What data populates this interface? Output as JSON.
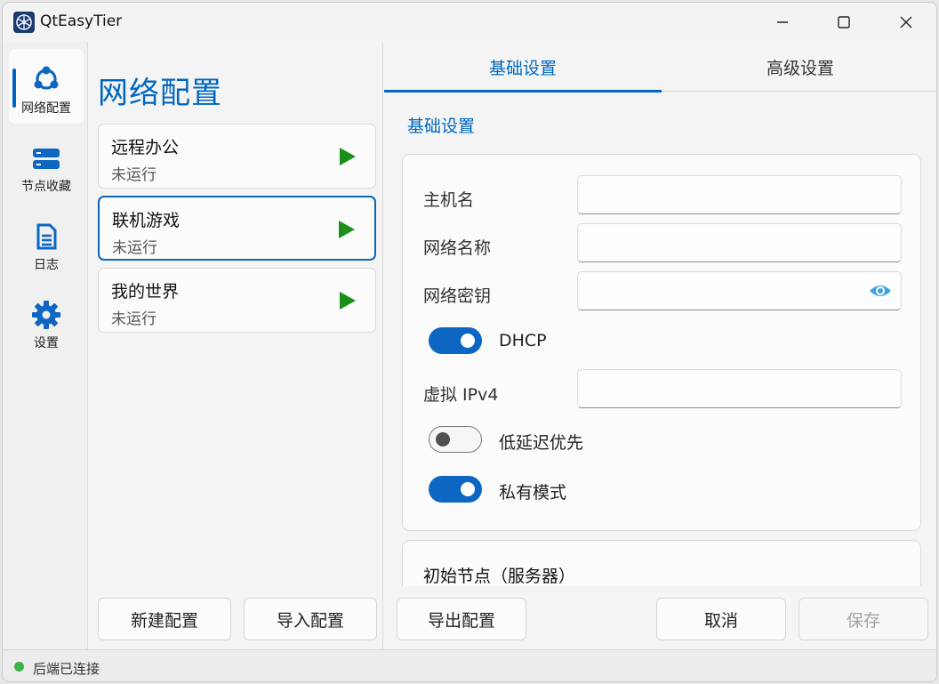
{
  "app": {
    "title": "QtEasyTier"
  },
  "nav": {
    "items": [
      {
        "label": "网络配置",
        "icon": "network-icon",
        "active": true
      },
      {
        "label": "节点收藏",
        "icon": "server-icon",
        "active": false
      },
      {
        "label": "日志",
        "icon": "document-icon",
        "active": false
      },
      {
        "label": "设置",
        "icon": "gear-icon",
        "active": false
      }
    ]
  },
  "config_list": {
    "title": "网络配置",
    "items": [
      {
        "name": "远程办公",
        "status": "未运行"
      },
      {
        "name": "联机游戏",
        "status": "未运行"
      },
      {
        "name": "我的世界",
        "status": "未运行"
      }
    ],
    "new_button": "新建配置",
    "import_button": "导入配置"
  },
  "tabs": [
    {
      "label": "基础设置",
      "active": true
    },
    {
      "label": "高级设置",
      "active": false
    }
  ],
  "basic": {
    "section_title": "基础设置",
    "hostname_label": "主机名",
    "hostname_value": "",
    "network_name_label": "网络名称",
    "network_name_value": "",
    "network_secret_label": "网络密钥",
    "network_secret_value": "",
    "dhcp_label": "DHCP",
    "dhcp_on": true,
    "ipv4_label": "虚拟 IPv4",
    "ipv4_value": "",
    "low_latency_label": "低延迟优先",
    "low_latency_on": false,
    "private_mode_label": "私有模式",
    "private_mode_on": true
  },
  "peers": {
    "title": "初始节点（服务器）"
  },
  "footer": {
    "export_button": "导出配置",
    "cancel_button": "取消",
    "save_button": "保存"
  },
  "statusbar": {
    "text": "后端已连接"
  },
  "colors": {
    "accent": "#0067c0",
    "play": "#1a8f1a",
    "status_ok": "#3cb34a"
  }
}
